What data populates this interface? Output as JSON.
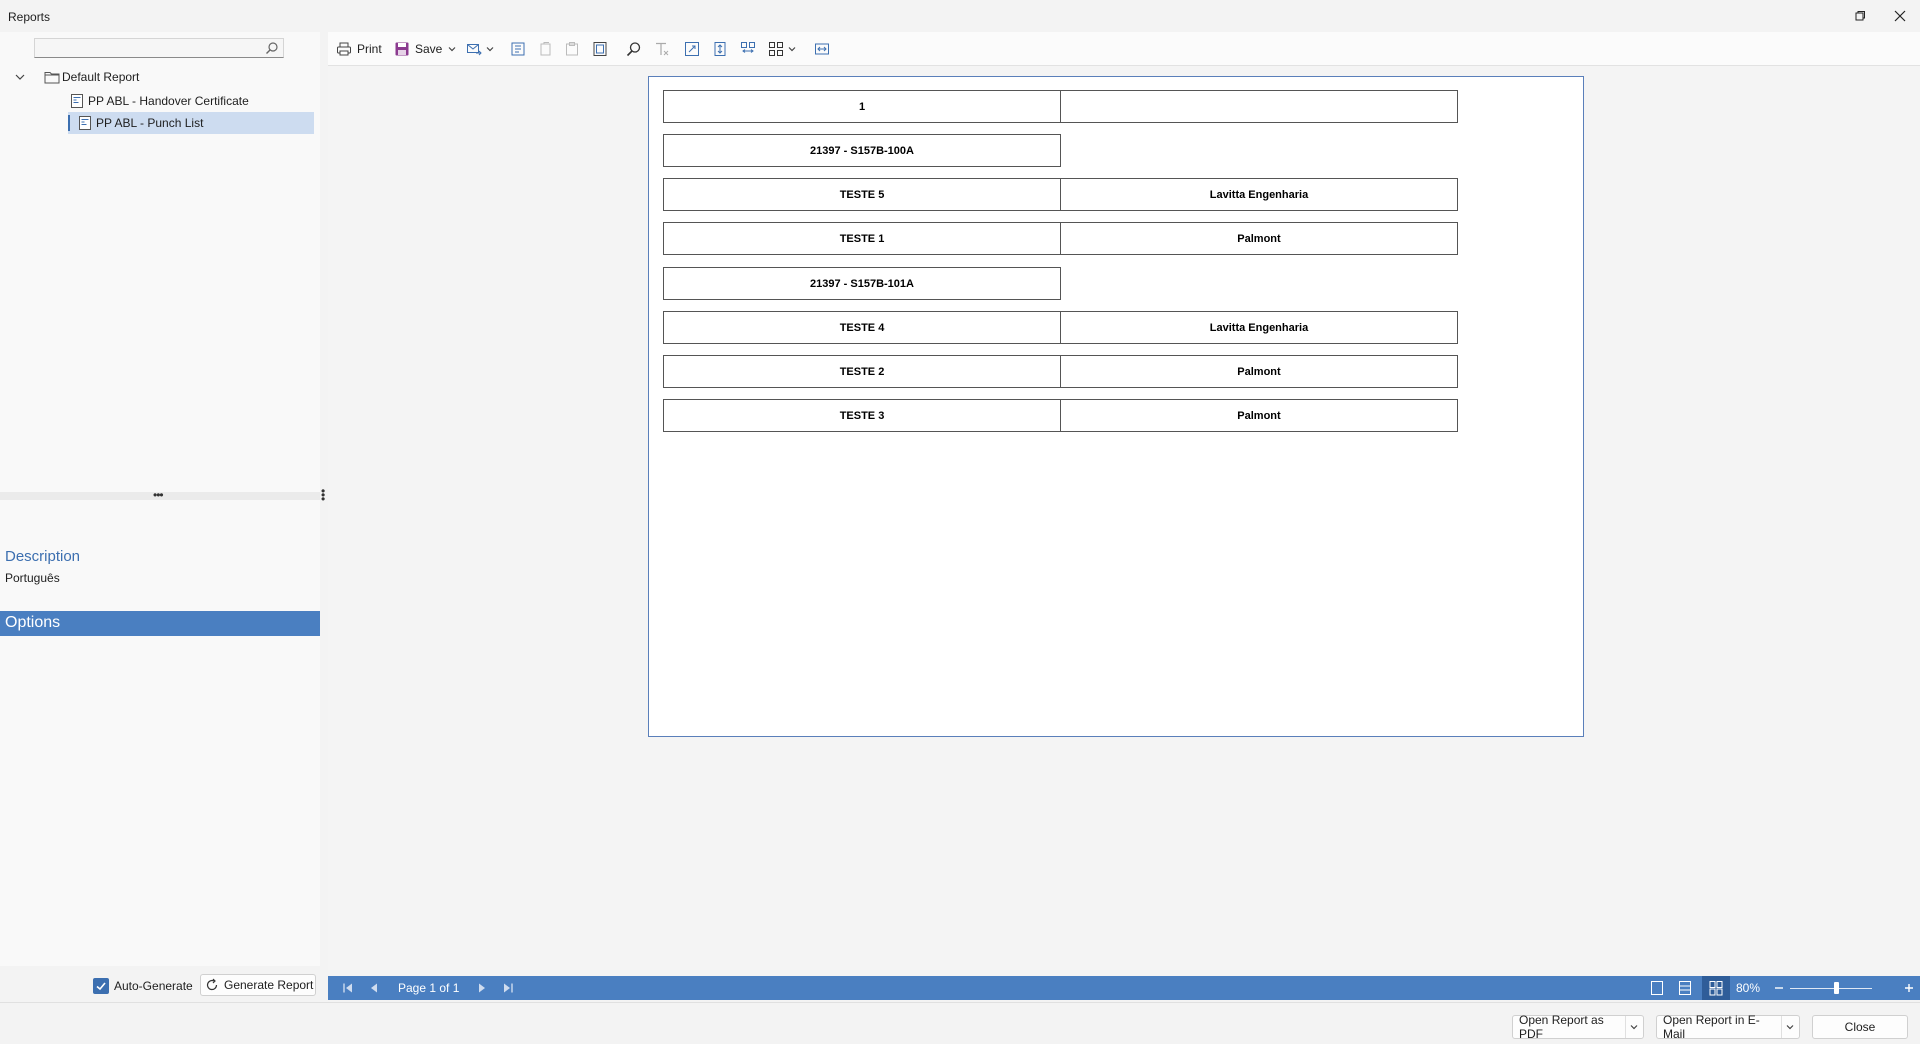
{
  "window": {
    "title": "Reports"
  },
  "search": {
    "placeholder": "",
    "value": ""
  },
  "tree": {
    "root": "Default Report",
    "items": [
      "PP ABL - Handover Certificate",
      "PP ABL - Punch List"
    ]
  },
  "description": {
    "title": "Description",
    "text": "Português"
  },
  "options": {
    "title": "Options"
  },
  "left_bottom": {
    "auto_generate_label": "Auto-Generate",
    "auto_generate_checked": true,
    "generate_label": "Generate Report"
  },
  "toolbar": {
    "print_label": "Print",
    "save_label": "Save"
  },
  "report": {
    "rows": [
      {
        "left": "1",
        "right": ""
      },
      {
        "left": "21397 - S157B-100A"
      },
      {
        "left": "TESTE 5",
        "right": "Lavitta Engenharia"
      },
      {
        "left": "TESTE 1",
        "right": "Palmont"
      },
      {
        "left": "21397 - S157B-101A"
      },
      {
        "left": "TESTE 4",
        "right": "Lavitta Engenharia"
      },
      {
        "left": "TESTE 2",
        "right": "Palmont"
      },
      {
        "left": "TESTE 3",
        "right": "Palmont"
      }
    ]
  },
  "statusbar": {
    "page_label": "Page 1 of 1",
    "zoom_label": "80%",
    "zoom_percent": 80
  },
  "bottom": {
    "pdf_label": "Open Report as PDF",
    "email_label": "Open Report in E-Mail",
    "close_label": "Close"
  },
  "colors": {
    "accent": "#4a7fc1",
    "selection": "#cddcf0"
  }
}
